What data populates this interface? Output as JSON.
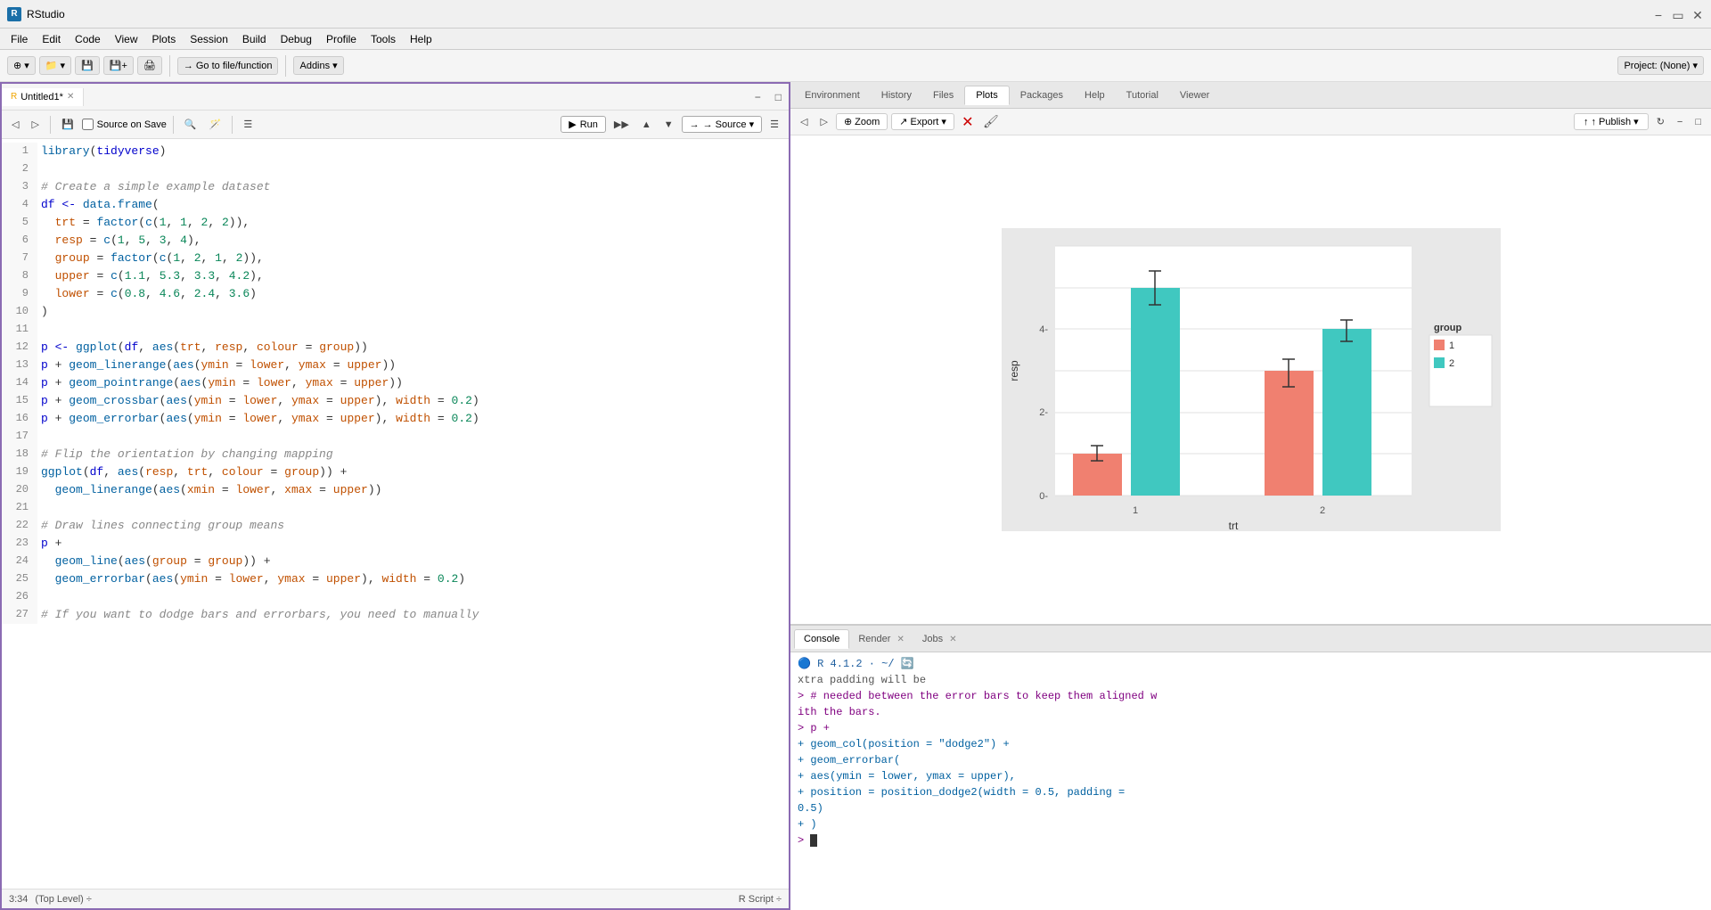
{
  "titlebar": {
    "title": "RStudio",
    "icon_label": "R"
  },
  "menubar": {
    "items": [
      "File",
      "Edit",
      "Code",
      "View",
      "Plots",
      "Session",
      "Build",
      "Debug",
      "Profile",
      "Tools",
      "Help"
    ]
  },
  "toolbar": {
    "new_btn": "⊕",
    "open_btn": "📁",
    "save_btn": "💾",
    "go_to_file": "Go to file/function",
    "addins": "Addins ▾",
    "project": "Project: (None) ▾"
  },
  "editor": {
    "tab_name": "Untitled1*",
    "source_on_save": "Source on Save",
    "run_label": "▶ Run",
    "source_label": "→ Source ▾",
    "status_pos": "3:34",
    "status_level": "(Top Level) ÷",
    "script_type": "R Script ÷",
    "lines": [
      {
        "num": 1,
        "html": "<span class='fn'>library</span><span class='paren'>(</span><span class='kw'>tidyverse</span><span class='paren'>)</span>"
      },
      {
        "num": 2,
        "html": ""
      },
      {
        "num": 3,
        "html": "<span class='comment'># Create a simple example dataset</span>"
      },
      {
        "num": 4,
        "html": "<span class='kw'>df</span> <span class='assign'>&lt;-</span> <span class='fn'>data.frame</span><span class='paren'>(</span>"
      },
      {
        "num": 5,
        "html": "  <span class='arg'>trt</span> <span class='op'>=</span> <span class='fn'>factor</span><span class='paren'>(</span><span class='fn'>c</span><span class='paren'>(</span><span class='num'>1</span>, <span class='num'>1</span>, <span class='num'>2</span>, <span class='num'>2</span><span class='paren'>)),</span>"
      },
      {
        "num": 6,
        "html": "  <span class='arg'>resp</span> <span class='op'>=</span> <span class='fn'>c</span><span class='paren'>(</span><span class='num'>1</span>, <span class='num'>5</span>, <span class='num'>3</span>, <span class='num'>4</span><span class='paren'>),</span>"
      },
      {
        "num": 7,
        "html": "  <span class='arg'>group</span> <span class='op'>=</span> <span class='fn'>factor</span><span class='paren'>(</span><span class='fn'>c</span><span class='paren'>(</span><span class='num'>1</span>, <span class='num'>2</span>, <span class='num'>1</span>, <span class='num'>2</span><span class='paren'>)),</span>"
      },
      {
        "num": 8,
        "html": "  <span class='arg'>upper</span> <span class='op'>=</span> <span class='fn'>c</span><span class='paren'>(</span><span class='num'>1.1</span>, <span class='num'>5.3</span>, <span class='num'>3.3</span>, <span class='num'>4.2</span><span class='paren'>),</span>"
      },
      {
        "num": 9,
        "html": "  <span class='arg'>lower</span> <span class='op'>=</span> <span class='fn'>c</span><span class='paren'>(</span><span class='num'>0.8</span>, <span class='num'>4.6</span>, <span class='num'>2.4</span>, <span class='num'>3.6</span><span class='paren'>)</span>"
      },
      {
        "num": 10,
        "html": "<span class='paren'>)</span>"
      },
      {
        "num": 11,
        "html": ""
      },
      {
        "num": 12,
        "html": "<span class='kw'>p</span> <span class='assign'>&lt;-</span> <span class='fn'>ggplot</span><span class='paren'>(</span><span class='kw'>df</span>, <span class='fn'>aes</span><span class='paren'>(</span><span class='arg'>trt</span>, <span class='arg'>resp</span>, <span class='arg'>colour</span> <span class='op'>=</span> <span class='arg'>group</span><span class='paren'>))</span>"
      },
      {
        "num": 13,
        "html": "<span class='kw'>p</span> <span class='op'>+</span> <span class='fn'>geom_linerange</span><span class='paren'>(</span><span class='fn'>aes</span><span class='paren'>(</span><span class='arg'>ymin</span> <span class='op'>=</span> <span class='arg'>lower</span>, <span class='arg'>ymax</span> <span class='op'>=</span> <span class='arg'>upper</span><span class='paren'>))</span>"
      },
      {
        "num": 14,
        "html": "<span class='kw'>p</span> <span class='op'>+</span> <span class='fn'>geom_pointrange</span><span class='paren'>(</span><span class='fn'>aes</span><span class='paren'>(</span><span class='arg'>ymin</span> <span class='op'>=</span> <span class='arg'>lower</span>, <span class='arg'>ymax</span> <span class='op'>=</span> <span class='arg'>upper</span><span class='paren'>))</span>"
      },
      {
        "num": 15,
        "html": "<span class='kw'>p</span> <span class='op'>+</span> <span class='fn'>geom_crossbar</span><span class='paren'>(</span><span class='fn'>aes</span><span class='paren'>(</span><span class='arg'>ymin</span> <span class='op'>=</span> <span class='arg'>lower</span>, <span class='arg'>ymax</span> <span class='op'>=</span> <span class='arg'>upper</span><span class='paren'>)</span>, <span class='arg'>width</span> <span class='op'>=</span> <span class='num'>0.2</span><span class='paren'>)</span>"
      },
      {
        "num": 16,
        "html": "<span class='kw'>p</span> <span class='op'>+</span> <span class='fn'>geom_errorbar</span><span class='paren'>(</span><span class='fn'>aes</span><span class='paren'>(</span><span class='arg'>ymin</span> <span class='op'>=</span> <span class='arg'>lower</span>, <span class='arg'>ymax</span> <span class='op'>=</span> <span class='arg'>upper</span><span class='paren'>)</span>, <span class='arg'>width</span> <span class='op'>=</span> <span class='num'>0.2</span><span class='paren'>)</span>"
      },
      {
        "num": 17,
        "html": ""
      },
      {
        "num": 18,
        "html": "<span class='comment'># Flip the orientation by changing mapping</span>"
      },
      {
        "num": 19,
        "html": "<span class='fn'>ggplot</span><span class='paren'>(</span><span class='kw'>df</span>, <span class='fn'>aes</span><span class='paren'>(</span><span class='arg'>resp</span>, <span class='arg'>trt</span>, <span class='arg'>colour</span> <span class='op'>=</span> <span class='arg'>group</span><span class='paren'>))</span> <span class='op'>+</span>"
      },
      {
        "num": 20,
        "html": "  <span class='fn'>geom_linerange</span><span class='paren'>(</span><span class='fn'>aes</span><span class='paren'>(</span><span class='arg'>xmin</span> <span class='op'>=</span> <span class='arg'>lower</span>, <span class='arg'>xmax</span> <span class='op'>=</span> <span class='arg'>upper</span><span class='paren'>))</span>"
      },
      {
        "num": 21,
        "html": ""
      },
      {
        "num": 22,
        "html": "<span class='comment'># Draw lines connecting group means</span>"
      },
      {
        "num": 23,
        "html": "<span class='kw'>p</span> <span class='op'>+</span>"
      },
      {
        "num": 24,
        "html": "  <span class='fn'>geom_line</span><span class='paren'>(</span><span class='fn'>aes</span><span class='paren'>(</span><span class='arg'>group</span> <span class='op'>=</span> <span class='arg'>group</span><span class='paren'>))</span> <span class='op'>+</span>"
      },
      {
        "num": 25,
        "html": "  <span class='fn'>geom_errorbar</span><span class='paren'>(</span><span class='fn'>aes</span><span class='paren'>(</span><span class='arg'>ymin</span> <span class='op'>=</span> <span class='arg'>lower</span>, <span class='arg'>ymax</span> <span class='op'>=</span> <span class='arg'>upper</span><span class='paren'>)</span>, <span class='arg'>width</span> <span class='op'>=</span> <span class='num'>0.2</span><span class='paren'>)</span>"
      },
      {
        "num": 26,
        "html": ""
      },
      {
        "num": 27,
        "html": "<span class='comment'># If you want to dodge bars and errorbars, you need to manually</span>"
      }
    ]
  },
  "right_panel": {
    "top_tabs": [
      "Environment",
      "History",
      "Files",
      "Plots",
      "Packages",
      "Help",
      "Tutorial",
      "Viewer"
    ],
    "active_top_tab": "Plots",
    "plot_toolbar": {
      "zoom_label": "⊕ Zoom",
      "export_label": "↗ Export ▾",
      "publish_label": "↑ Publish ▾",
      "brush_label": "🖌"
    },
    "chart": {
      "title": "",
      "x_label": "trt",
      "y_label": "resp",
      "x_ticks": [
        "1",
        "2"
      ],
      "y_ticks": [
        "0-",
        "2-",
        "4-"
      ],
      "legend_title": "group",
      "legend_items": [
        {
          "label": "1",
          "color": "#f08070"
        },
        {
          "label": "2",
          "color": "#40c8c0"
        }
      ],
      "bars": [
        {
          "x": 1,
          "group": 1,
          "value": 1,
          "lower": 0.8,
          "upper": 1.1,
          "color": "#f08070"
        },
        {
          "x": 1,
          "group": 2,
          "value": 5,
          "lower": 4.6,
          "upper": 5.3,
          "color": "#40c8c0"
        },
        {
          "x": 2,
          "group": 1,
          "value": 3,
          "lower": 2.4,
          "upper": 3.3,
          "color": "#f08070"
        },
        {
          "x": 2,
          "group": 2,
          "value": 4,
          "lower": 3.6,
          "upper": 4.2,
          "color": "#40c8c0"
        }
      ]
    },
    "console_tabs": [
      "Console",
      "Render",
      "Jobs"
    ],
    "active_console_tab": "Console",
    "console_lines": [
      {
        "type": "output",
        "text": "xtra padding will be"
      },
      {
        "type": "prompt",
        "text": "> # needed between the error bars to keep them aligned w"
      },
      {
        "type": "continuation",
        "text": "ith the bars."
      },
      {
        "type": "prompt",
        "text": "> p +"
      },
      {
        "type": "continuation",
        "text": "+     geom_col(position = \"dodge2\") +"
      },
      {
        "type": "continuation",
        "text": "+     geom_errorbar("
      },
      {
        "type": "continuation",
        "text": "+         aes(ymin = lower, ymax = upper),"
      },
      {
        "type": "continuation",
        "text": "+         position = position_dodge2(width = 0.5, padding ="
      },
      {
        "type": "continuation",
        "text": "  0.5)"
      },
      {
        "type": "continuation",
        "text": "+     )"
      },
      {
        "type": "prompt-cursor",
        "text": "> "
      }
    ],
    "r_version": "R 4.1.2 · ~/",
    "console_header": "Console"
  }
}
